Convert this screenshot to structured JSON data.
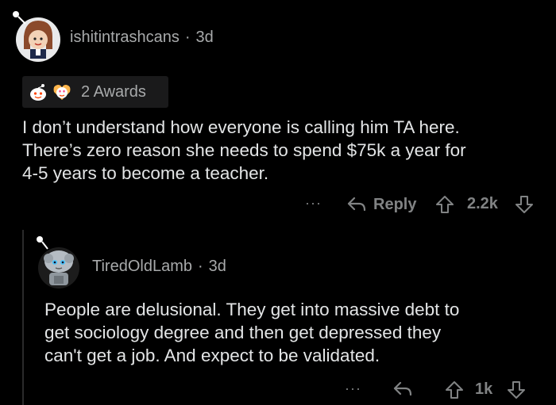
{
  "comment1": {
    "username": "ishitintrashcans",
    "separator": "·",
    "age": "3d",
    "awards_label": "2 Awards",
    "body_lines": [
      "I don’t understand how everyone is calling him TA here.",
      "There’s zero reason she needs to spend $75k a year for",
      "4-5 years to become a teacher."
    ],
    "more": "···",
    "reply_label": "Reply",
    "score": "2.2k"
  },
  "comment2": {
    "username": "TiredOldLamb",
    "separator": "·",
    "age": "3d",
    "body_lines": [
      "People are delusional. They get into massive debt to",
      "get sociology degree and then get depressed they",
      "can't get a job. And expect to be validated."
    ],
    "more": "···",
    "score": "1k"
  },
  "icons": {
    "award1": "happy-face-award-icon",
    "award2": "heart-eyes-award-icon",
    "reply": "reply-arrow-icon",
    "upvote": "upvote-arrow-icon",
    "downvote": "downvote-arrow-icon",
    "more": "more-dots-icon"
  },
  "colors": {
    "background": "#000000",
    "text": "#e3e5e6",
    "muted": "#a8aaab",
    "action": "#818384",
    "pill": "#1a1a1b"
  }
}
